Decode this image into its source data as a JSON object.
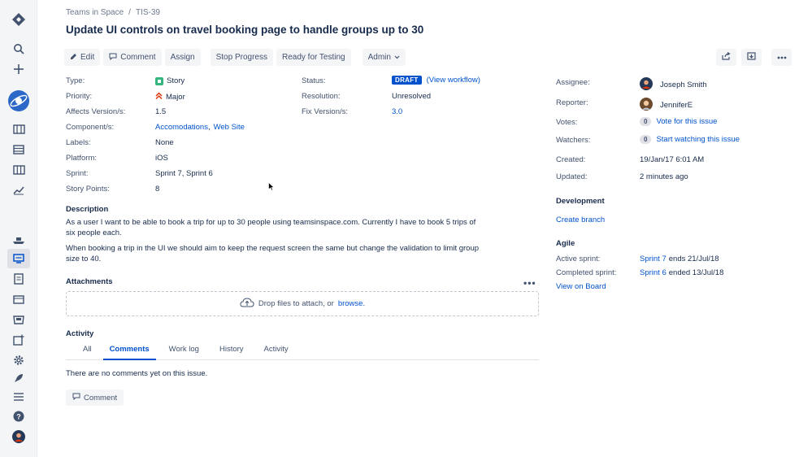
{
  "sidebar": {
    "icons": [
      "jira-logo-icon",
      "search-icon",
      "plus-icon",
      "project-avatar-icon",
      "backlog-icon",
      "board-icon",
      "columns-icon",
      "reports-icon",
      "ship-icon",
      "issues-icon",
      "pages-icon",
      "calendar-icon",
      "releases-icon",
      "add-item-icon",
      "settings-icon",
      "rocket-icon",
      "menu-icon",
      "help-icon",
      "profile-avatar-icon"
    ]
  },
  "breadcrumb": {
    "project": "Teams in Space",
    "separator": "/",
    "issue_key": "TIS-39"
  },
  "title": "Update UI controls on travel booking page to handle groups up to 30",
  "toolbar": {
    "edit": "Edit",
    "comment": "Comment",
    "assign": "Assign",
    "stop_progress": "Stop Progress",
    "ready_for_testing": "Ready for Testing",
    "admin": "Admin"
  },
  "details": {
    "type_label": "Type:",
    "type_value": "Story",
    "priority_label": "Priority:",
    "priority_value": "Major",
    "affects_label": "Affects Version/s:",
    "affects_value": "1.5",
    "components_label": "Component/s:",
    "component_1": "Accomodations",
    "component_sep": ",",
    "component_2": "Web Site",
    "labels_label": "Labels:",
    "labels_value": "None",
    "platform_label": "Platform:",
    "platform_value": "iOS",
    "sprint_label": "Sprint:",
    "sprint_value": "Sprint 7, Sprint 6",
    "points_label": "Story Points:",
    "points_value": "8",
    "status_label": "Status:",
    "status_value": "DRAFT",
    "view_workflow": "(View workflow)",
    "resolution_label": "Resolution:",
    "resolution_value": "Unresolved",
    "fix_label": "Fix Version/s:",
    "fix_value": "3.0"
  },
  "description": {
    "heading": "Description",
    "p1_line1": "As a user I want to be able to book a trip for up to 30 people using teamsinspace.com. Currently I have to book 5 trips of",
    "p1_line2": "six people each.",
    "p2_line1": "When booking a trip in the UI we should aim to keep the request screen the same but change the validation to limit group",
    "p2_line2": "size to 40."
  },
  "attachments": {
    "heading": "Attachments",
    "more": "•••",
    "drop_text": "Drop files to attach, or",
    "browse": "browse."
  },
  "activity": {
    "heading": "Activity",
    "tabs": [
      "All",
      "Comments",
      "Work log",
      "History",
      "Activity"
    ],
    "active_tab": "Comments",
    "empty": "There are no comments yet on this issue.",
    "comment_button": "Comment"
  },
  "people": {
    "assignee_label": "Assignee:",
    "assignee": "Joseph Smith",
    "reporter_label": "Reporter:",
    "reporter": "JenniferE",
    "votes_label": "Votes:",
    "votes_count": "0",
    "vote_link": "Vote for this issue",
    "watchers_label": "Watchers:",
    "watchers_count": "0",
    "watch_link": "Start watching this issue"
  },
  "dates": {
    "created_label": "Created:",
    "created": "19/Jan/17 6:01 AM",
    "updated_label": "Updated:",
    "updated": "2 minutes ago"
  },
  "development": {
    "heading": "Development",
    "create_branch": "Create branch"
  },
  "agile": {
    "heading": "Agile",
    "active_label": "Active sprint:",
    "active_sprint": "Sprint 7",
    "active_ends": "ends 21/Jul/18",
    "completed_label": "Completed sprint:",
    "completed_sprint": "Sprint 6",
    "completed_ended": "ended 13/Jul/18",
    "view_on_board": "View on Board"
  },
  "colors": {
    "link": "#0052cc",
    "story": "#36b37e",
    "major": "#de350b",
    "text": "#172b4d",
    "muted": "#42526e"
  }
}
